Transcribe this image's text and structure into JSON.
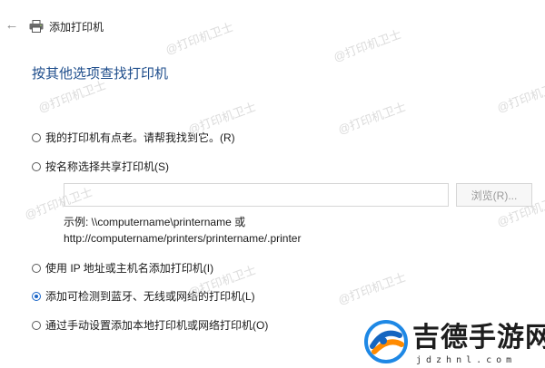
{
  "window": {
    "title": "添加打印机",
    "back_icon": "back-arrow-icon"
  },
  "page": {
    "heading": "按其他选项查找打印机"
  },
  "options": [
    {
      "label": "我的打印机有点老。请帮我找到它。(R)",
      "checked": false
    },
    {
      "label": "按名称选择共享打印机(S)",
      "checked": false
    },
    {
      "label": "使用 IP 地址或主机名添加打印机(I)",
      "checked": false
    },
    {
      "label": "添加可检测到蓝牙、无线或网络的打印机(L)",
      "checked": true
    },
    {
      "label": "通过手动设置添加本地打印机或网络打印机(O)",
      "checked": false
    }
  ],
  "shared_printer": {
    "input_value": "",
    "browse_label": "浏览(R)...",
    "example_line1": "示例: \\\\computername\\printername 或",
    "example_line2": "http://computername/printers/printername/.printer"
  },
  "watermark": {
    "text": "@打印机卫士"
  },
  "site_logo": {
    "text": "吉德手游网",
    "domain": "jdzhnl.com"
  },
  "colors": {
    "heading": "#1f4e8c",
    "accent": "#1a66c8"
  }
}
